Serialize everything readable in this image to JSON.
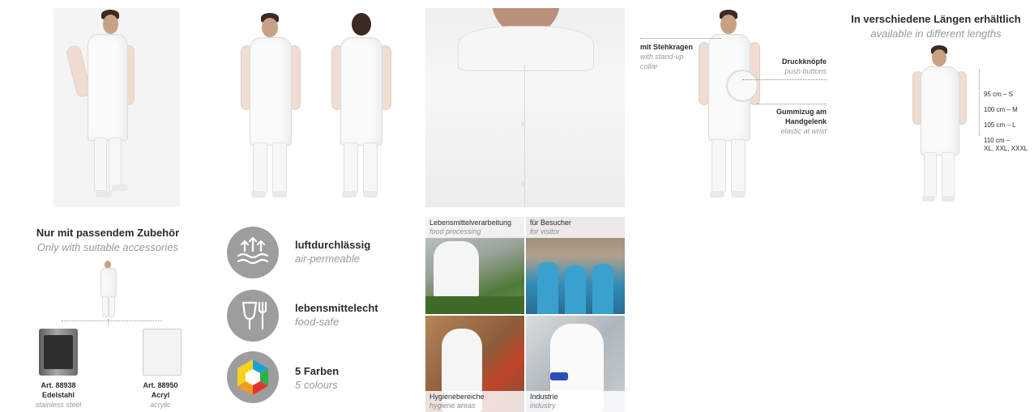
{
  "colors": {
    "icon_grey": "#9d9d9d",
    "muted_text": "#9a9a9a",
    "coat_white": "#fafafa"
  },
  "callouts": {
    "collar_de": "mit Stehkragen",
    "collar_en_1": "with stand-up",
    "collar_en_2": "collar",
    "buttons_de": "Druckknöpfe",
    "buttons_en": "push buttons",
    "wrist_de_1": "Gummizug am",
    "wrist_de_2": "Handgelenk",
    "wrist_en": "elastic at wrist"
  },
  "lengths": {
    "title_de": "In verschiedene Längen erhältlich",
    "title_en": "available in different lengths",
    "items": [
      "95 cm – S",
      "100 cm – M",
      "105 cm – L",
      "110 cm –",
      "XL, XXL, XXXL"
    ]
  },
  "accessories": {
    "title_de": "Nur mit passendem Zubehör",
    "title_en": "Only with suitable accessories",
    "item1": {
      "art": "Art. 88938",
      "de": "Edelstahl",
      "en": "stainless steel"
    },
    "item2": {
      "art": "Art. 88950",
      "de": "Acryl",
      "en": "acrylic"
    }
  },
  "features": [
    {
      "de": "luftdurchlässig",
      "en": "air-permeable",
      "icon": "air-permeable-icon"
    },
    {
      "de": "lebensmittelecht",
      "en": "food-safe",
      "icon": "fork-glass-icon"
    },
    {
      "de": "5 Farben",
      "en": "5 colours",
      "icon": "color-hexagon-icon"
    }
  ],
  "usage": {
    "tl": {
      "de": "Lebensmittelverarbeitung",
      "en": "food processing"
    },
    "tr": {
      "de": "für Besucher",
      "en": "for visitor"
    },
    "bl": {
      "de": "Hygienebereiche",
      "en": "hygiene areas"
    },
    "br": {
      "de": "Industrie",
      "en": "industry"
    }
  }
}
